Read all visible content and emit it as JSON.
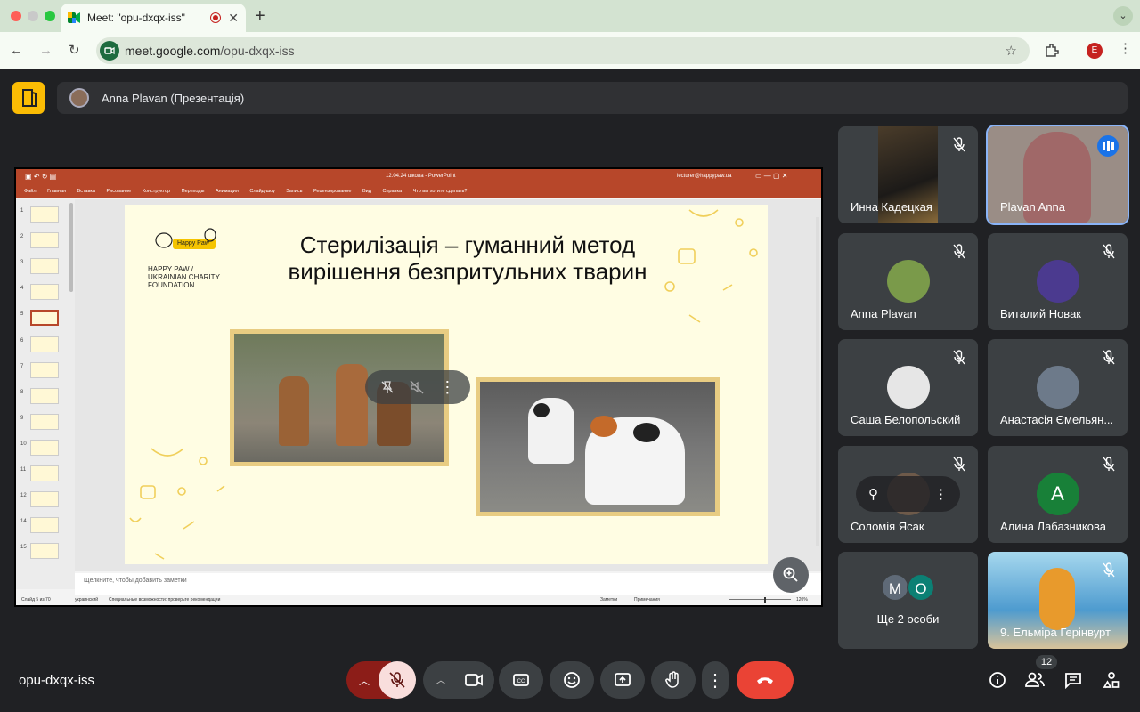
{
  "browser": {
    "tab_title": "Meet: \"opu-dxqx-iss\"",
    "new_tab": "+",
    "url_host": "meet.google.com",
    "url_path": "/opu-dxqx-iss",
    "profile_initial": "E"
  },
  "meet": {
    "presenter_label": "Anna Plavan (Презентація)",
    "meeting_code": "opu-dxqx-iss",
    "participant_count": "12",
    "more_people": {
      "label": "Ще 2 особи",
      "initials": [
        "M",
        "O"
      ]
    }
  },
  "participants": [
    {
      "name": "Инна Кадецкая",
      "muted": true
    },
    {
      "name": "Plavan Anna",
      "muted": false,
      "speaking": true
    },
    {
      "name": "Anna Plavan",
      "muted": true
    },
    {
      "name": "Виталий Новак",
      "muted": true
    },
    {
      "name": "Саша Белопольский",
      "muted": true
    },
    {
      "name": "Анастасія Ємельян...",
      "muted": true
    },
    {
      "name": "Соломія Ясак",
      "muted": true
    },
    {
      "name": "Алина Лабазникова",
      "muted": true,
      "initial": "A"
    },
    {
      "name": "9. Ельміра Герінвурт",
      "muted": true
    }
  ],
  "colors": {
    "accent_blue": "#8ab4f8",
    "end_call_red": "#ea4335",
    "mic_off_bg": "#f9dedc",
    "exit_yellow": "#fbbc04",
    "avatar_green": "#188038"
  },
  "powerpoint": {
    "window_title": "12.04.24 школа  -  PowerPoint",
    "user_email": "lecturer@happypaw.ua",
    "menu": [
      "Файл",
      "Главная",
      "Вставка",
      "Рисование",
      "Конструктор",
      "Переходы",
      "Анимация",
      "Слайд-шоу",
      "Запись",
      "Рецензирование",
      "Вид",
      "Справка"
    ],
    "tell_me": "Что вы хотите сделать?",
    "thumbnail_numbers": [
      "1",
      "2",
      "3",
      "4",
      "5",
      "6",
      "7",
      "8",
      "9",
      "10",
      "11",
      "12",
      "14",
      "15"
    ],
    "notes_placeholder": "Щелкните, чтобы добавить заметки",
    "status_slide": "Слайд 5 из 70",
    "status_language": "украинский",
    "status_accessibility": "Специальные возможности: проверьте рекомендации",
    "status_notes": "Заметки",
    "status_comments": "Примечания",
    "zoom": "120%",
    "slide": {
      "title_line1": "Стерилізація – гуманний метод",
      "title_line2": "вирішення безпритульних тварин",
      "logo_badge": "Happy Paw",
      "org_line1": "HAPPY PAW /",
      "org_line2": "UKRAINIAN CHARITY",
      "org_line3": "FOUNDATION"
    }
  }
}
